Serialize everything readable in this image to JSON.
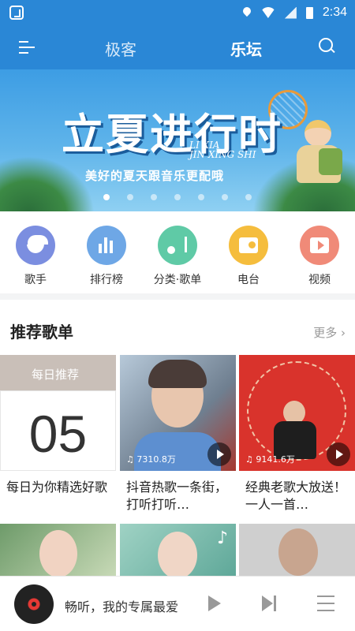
{
  "status": {
    "time": "2:34"
  },
  "header": {
    "tabs": [
      {
        "label": "极客",
        "active": false
      },
      {
        "label": "乐坛",
        "active": true
      }
    ]
  },
  "banner": {
    "title": "立夏进行时",
    "english_line1": "LI XIA",
    "english_line2": "JIN XING SHI",
    "subtitle": "美好的夏天跟音乐更配哦",
    "page_count": 7,
    "active_page": 0
  },
  "quick_entries": [
    {
      "label": "歌手",
      "icon": "singer-icon",
      "color": "#7b8ee0"
    },
    {
      "label": "排行榜",
      "icon": "chart-bars-icon",
      "color": "#6ea7e6"
    },
    {
      "label": "分类·歌单",
      "icon": "music-note-icon",
      "color": "#5fcaa6"
    },
    {
      "label": "电台",
      "icon": "radio-icon",
      "color": "#f5bd3d"
    },
    {
      "label": "视频",
      "icon": "video-icon",
      "color": "#f08a78"
    }
  ],
  "recommend": {
    "title": "推荐歌单",
    "more": "更多",
    "daily_label": "每日推荐",
    "daily_number": "05",
    "playlists": [
      {
        "title": "每日为你精选好歌",
        "plays": ""
      },
      {
        "title": "抖音热歌一条街，打听打听…",
        "plays": "7310.8万"
      },
      {
        "title": "经典老歌大放送！一人一首…",
        "plays": "9141.6万"
      }
    ]
  },
  "player": {
    "now_playing": "畅听，我的专属最爱"
  },
  "colors": {
    "brand": "#2a87d6",
    "accent_red": "#e53935"
  }
}
